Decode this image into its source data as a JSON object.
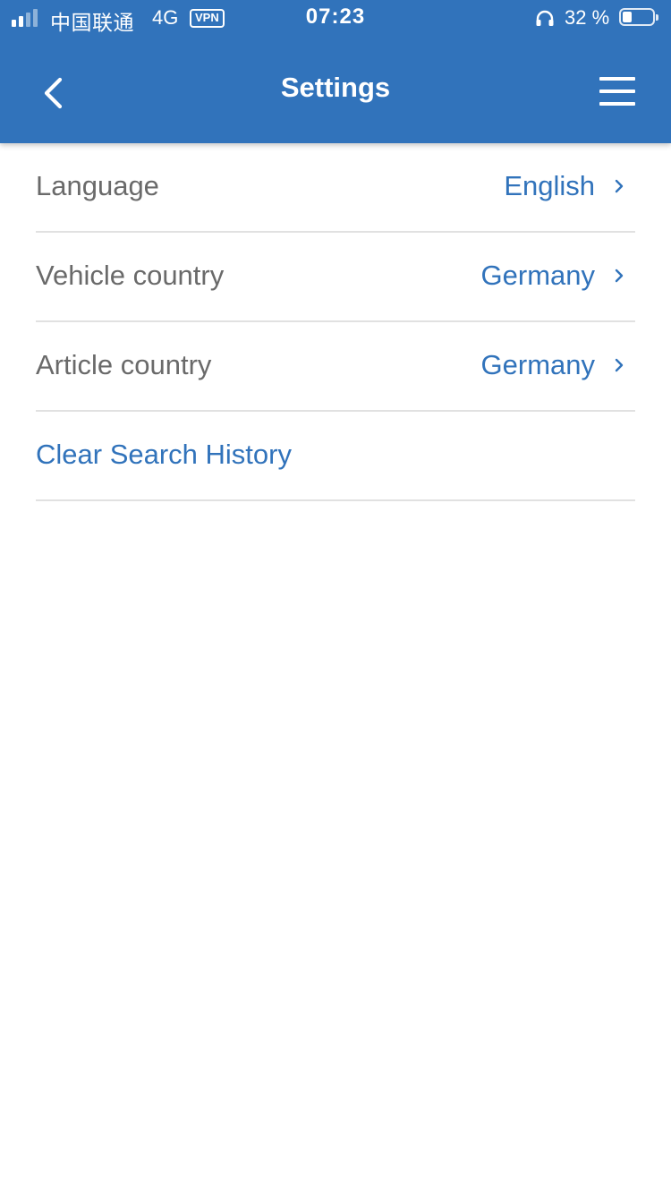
{
  "status_bar": {
    "carrier": "中国联通",
    "network": "4G",
    "vpn": "VPN",
    "time": "07:23",
    "battery_percent": "32 %",
    "battery_level": 0.32,
    "signal_bars_active": 2,
    "signal_bars_total": 4
  },
  "nav": {
    "title": "Settings",
    "back_icon": "chevron-left-icon",
    "menu_icon": "hamburger-menu-icon"
  },
  "settings": {
    "language": {
      "label": "Language",
      "value": "English"
    },
    "vehicle_country": {
      "label": "Vehicle country",
      "value": "Germany"
    },
    "article_country": {
      "label": "Article country",
      "value": "Germany"
    },
    "clear_history": {
      "label": "Clear Search History"
    }
  },
  "colors": {
    "accent": "#3173bb",
    "label_text": "#6a6a6a",
    "divider": "#e1e1e1",
    "background": "#ffffff"
  }
}
